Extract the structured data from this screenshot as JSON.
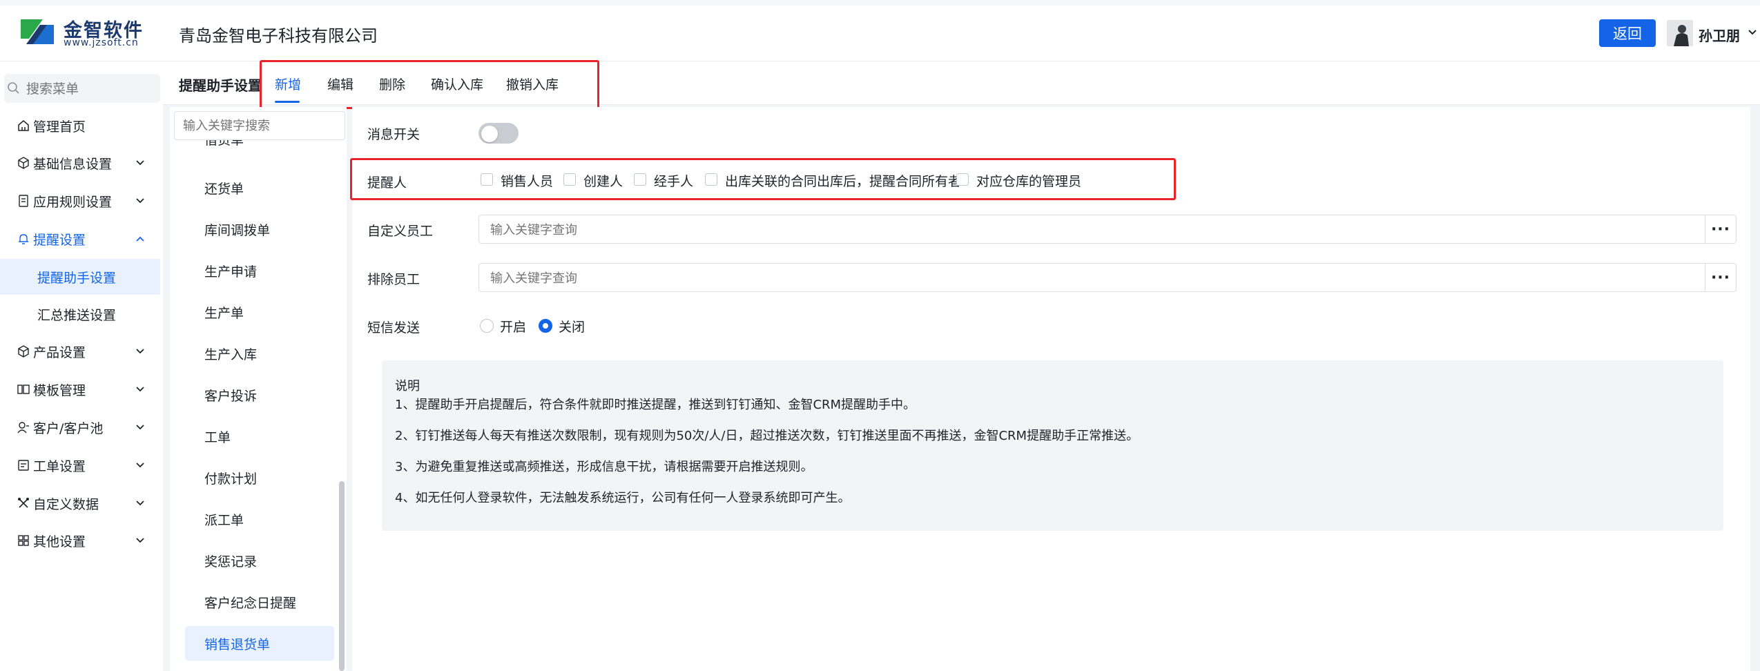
{
  "header": {
    "logo_name": "金智软件",
    "logo_url": "www.jzsoft.cn",
    "company_name": "青岛金智电子科技有限公司",
    "return_label": "返回",
    "user_name": "孙卫朋"
  },
  "sidebar": {
    "search_placeholder": "搜索菜单",
    "items": [
      {
        "label": "管理首页",
        "icon": "home-icon"
      },
      {
        "label": "基础信息设置",
        "icon": "cube-icon"
      },
      {
        "label": "应用规则设置",
        "icon": "document-icon"
      },
      {
        "label": "提醒设置",
        "icon": "bell-icon"
      },
      {
        "label": "提醒助手设置"
      },
      {
        "label": "汇总推送设置"
      },
      {
        "label": "产品设置",
        "icon": "cube-icon"
      },
      {
        "label": "模板管理",
        "icon": "template-icon"
      },
      {
        "label": "客户/客户池",
        "icon": "contacts-icon"
      },
      {
        "label": "工单设置",
        "icon": "ticket-icon"
      },
      {
        "label": "自定义数据",
        "icon": "tools-icon"
      },
      {
        "label": "其他设置",
        "icon": "grid-icon"
      }
    ]
  },
  "content": {
    "section_title": "提醒助手设置",
    "tabs": [
      "新增",
      "编辑",
      "删除",
      "确认入库",
      "撤销入库"
    ]
  },
  "list": {
    "search_placeholder": "输入关键字搜索",
    "partial_item": "借货单",
    "items": [
      "还货单",
      "库间调拨单",
      "生产申请",
      "生产单",
      "生产入库",
      "客户投诉",
      "工单",
      "付款计划",
      "派工单",
      "奖惩记录",
      "客户纪念日提醒",
      "销售退货单"
    ]
  },
  "form": {
    "message_switch_label": "消息开关",
    "message_switch_on": false,
    "reminder_label": "提醒人",
    "reminder_options": [
      "销售人员",
      "创建人",
      "经手人",
      "出库关联的合同出库后，提醒合同所有者",
      "对应仓库的管理员"
    ],
    "custom_staff_label": "自定义员工",
    "custom_staff_placeholder": "输入关键字查询",
    "exclude_staff_label": "排除员工",
    "exclude_staff_placeholder": "输入关键字查询",
    "more_label": "···",
    "sms_label": "短信发送",
    "sms_options": [
      "开启",
      "关闭"
    ],
    "sms_selected": "关闭"
  },
  "notes": {
    "title": "说明",
    "lines": [
      "1、提醒助手开启提醒后，符合条件就即时推送提醒，推送到钉钉通知、金智CRM提醒助手中。",
      "2、钉钉推送每人每天有推送次数限制，现有规则为50次/人/日，超过推送次数，钉钉推送里面不再推送，金智CRM提醒助手正常推送。",
      "3、为避免重复推送或高频推送，形成信息干扰，请根据需要开启推送规则。",
      "4、如无任何人登录软件，无法触发系统运行，公司有任何一人登录系统即可产生。"
    ]
  },
  "colors": {
    "accent": "#1464e8",
    "highlight_border": "#e8232a"
  }
}
